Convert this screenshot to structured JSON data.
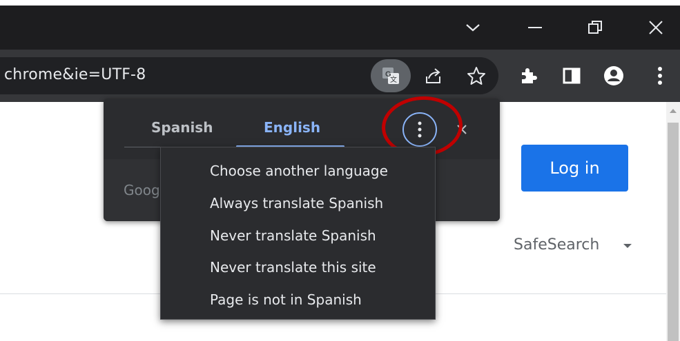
{
  "window_controls": {
    "tab_search": "chevron-down-icon",
    "minimize": "minimize-icon",
    "restore": "restore-icon",
    "close": "close-icon"
  },
  "toolbar": {
    "url_text": "chrome&ie=UTF-8",
    "icons": [
      "translate-icon",
      "share-icon",
      "star-icon",
      "extensions-icon",
      "side-panel-icon",
      "profile-icon",
      "kebab-menu-icon"
    ]
  },
  "page": {
    "login_label": "Log in",
    "safesearch_label": "SafeSearch",
    "colors": {
      "login_button": "#1a73e8"
    }
  },
  "translate_bubble": {
    "tabs": [
      {
        "label": "Spanish",
        "selected": false
      },
      {
        "label": "English",
        "selected": true
      }
    ],
    "partial_text": "Goog",
    "colors": {
      "accent": "#8ab4f8",
      "annotation_circle": "#c00000"
    }
  },
  "menu": {
    "items": [
      {
        "label": "Choose another language"
      },
      {
        "label": "Always translate Spanish"
      },
      {
        "label": "Never translate Spanish"
      },
      {
        "label": "Never translate this site"
      },
      {
        "label": "Page is not in Spanish"
      }
    ]
  }
}
